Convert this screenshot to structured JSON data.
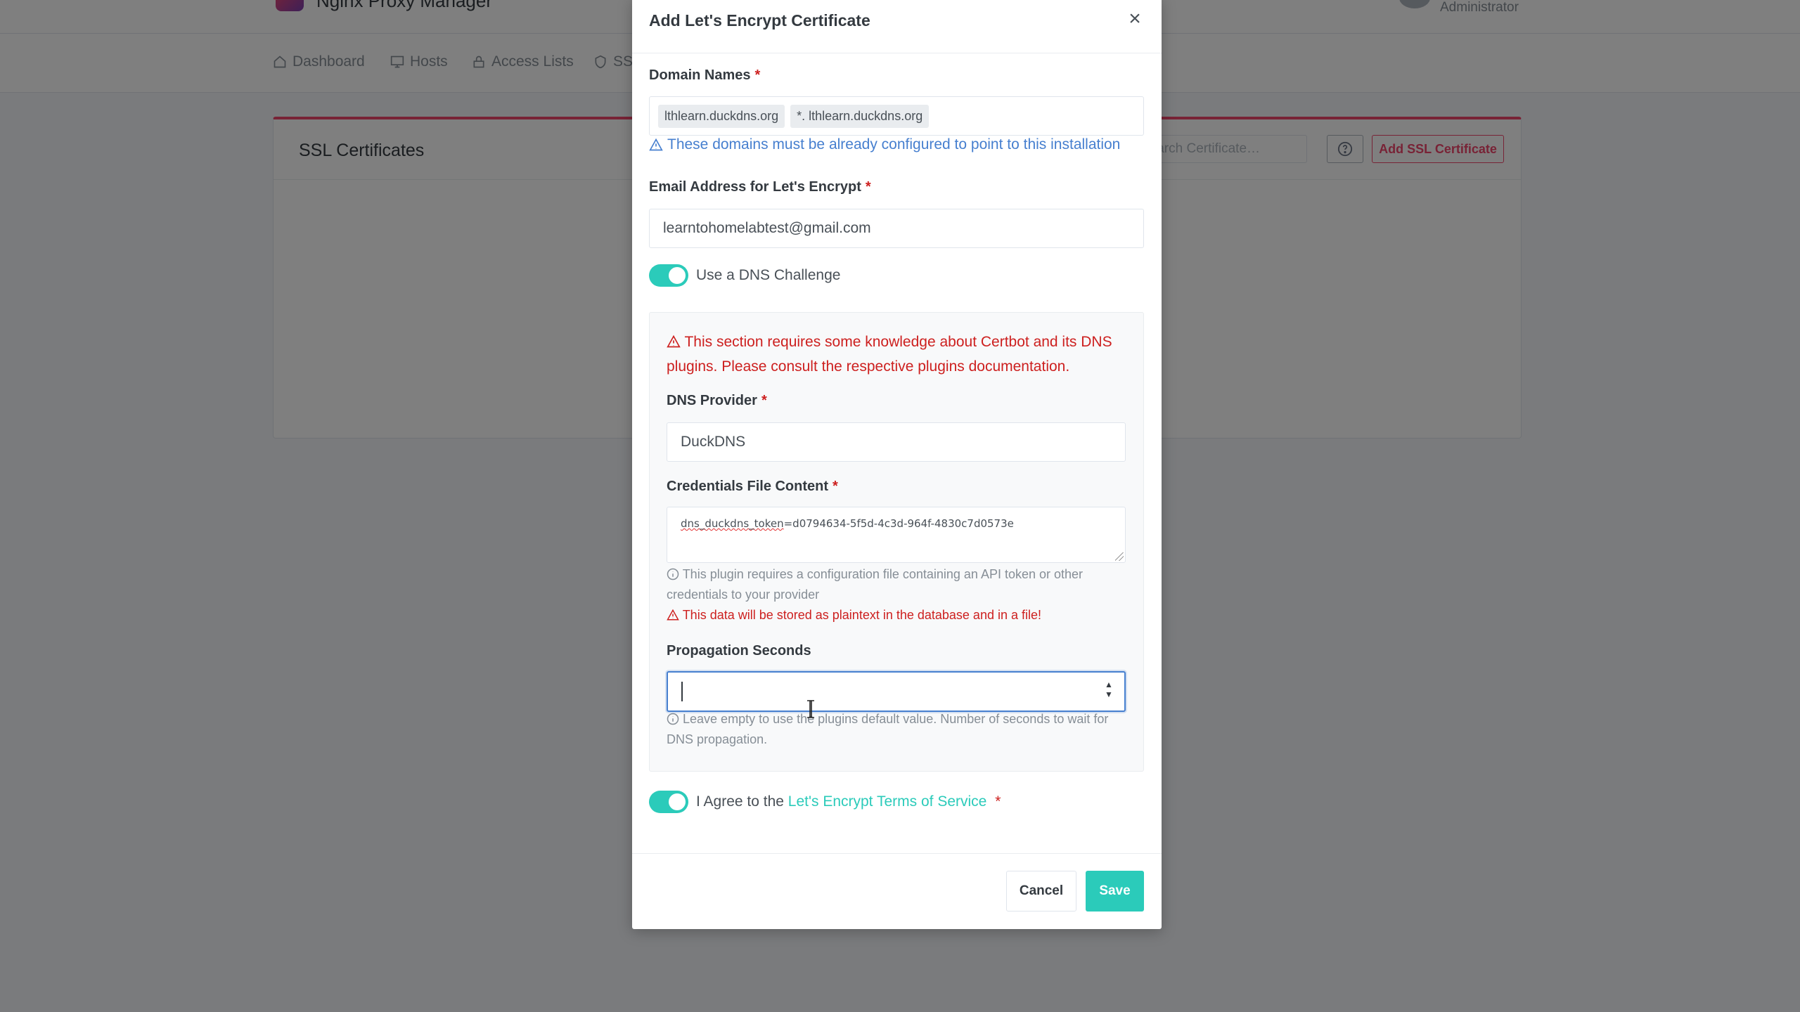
{
  "app": {
    "brand_title": "Nginx Proxy Manager",
    "user_role": "Administrator",
    "nav": [
      "Dashboard",
      "Hosts",
      "Access Lists",
      "SSL Certificates"
    ],
    "card_title": "SSL Certificates",
    "search_placeholder": "Search Certificate…",
    "add_button": "Add SSL Certificate"
  },
  "modal": {
    "title": "Add Let's Encrypt Certificate",
    "close": "×",
    "domain_label": "Domain Names",
    "domains": [
      "lthlearn.duckdns.org",
      "*. lthlearn.duckdns.org"
    ],
    "domain_hint": "These domains must be already configured to point to this installation",
    "email_label": "Email Address for Let's Encrypt",
    "email_value": "learntohomelabtest@gmail.com",
    "dns_toggle_label": "Use a DNS Challenge",
    "dns_warning": "This section requires some knowledge about Certbot and its DNS plugins. Please consult the respective plugins documentation.",
    "provider_label": "DNS Provider",
    "provider_value": "DuckDNS",
    "credentials_label": "Credentials File Content",
    "credentials_key": "dns_duckdns_token",
    "credentials_rest": "=d0794634-5f5d-4c3d-964f-4830c7d0573e",
    "credentials_note": "This plugin requires a configuration file containing an API token or other credentials to your provider",
    "credentials_warning": "This data will be stored as plaintext in the database and in a file!",
    "propagation_label": "Propagation Seconds",
    "propagation_value": "",
    "propagation_note": "Leave empty to use the plugins default value. Number of seconds to wait for DNS propagation.",
    "agree_prefix": "I Agree to the",
    "agree_link": "Let's Encrypt Terms of Service",
    "required_mark": "*",
    "cancel": "Cancel",
    "save": "Save"
  },
  "colors": {
    "accent": "#2bcbba",
    "danger": "#cd201f",
    "info": "#467fcf",
    "brand": "#f1466d"
  }
}
